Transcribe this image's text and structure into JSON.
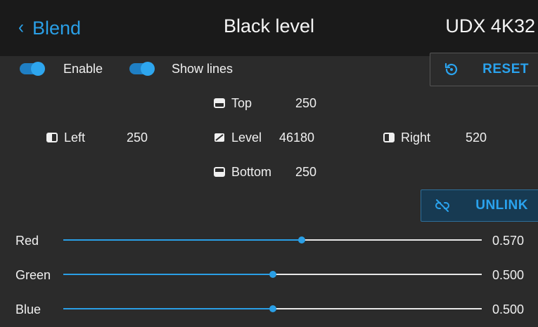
{
  "header": {
    "back_label": "Blend",
    "title": "Black level",
    "device": "UDX 4K32"
  },
  "toggles": {
    "enable_label": "Enable",
    "enable_on": true,
    "show_lines_label": "Show lines",
    "show_lines_on": true
  },
  "buttons": {
    "reset_label": "RESET",
    "unlink_label": "UNLINK"
  },
  "edges": {
    "top_label": "Top",
    "top_value": "250",
    "left_label": "Left",
    "left_value": "250",
    "level_label": "Level",
    "level_value": "46180",
    "right_label": "Right",
    "right_value": "520",
    "bottom_label": "Bottom",
    "bottom_value": "250"
  },
  "sliders": [
    {
      "label": "Red",
      "value": "0.570",
      "fraction": 0.57
    },
    {
      "label": "Green",
      "value": "0.500",
      "fraction": 0.5
    },
    {
      "label": "Blue",
      "value": "0.500",
      "fraction": 0.5
    }
  ],
  "colors": {
    "accent": "#2a9fe6",
    "background": "#2b2b2b",
    "header_background": "#1a1a1a"
  }
}
